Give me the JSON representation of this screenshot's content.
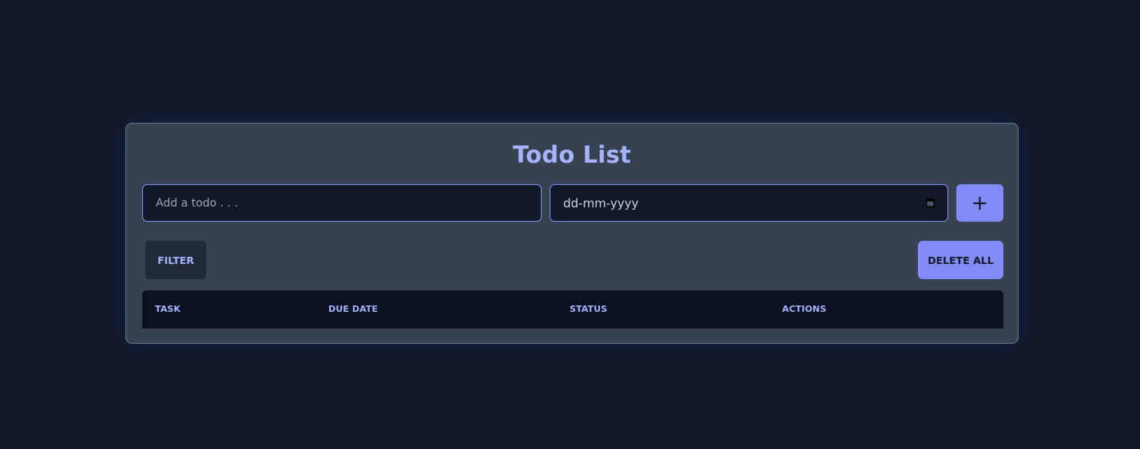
{
  "app": {
    "title": "Todo List"
  },
  "form": {
    "todo_placeholder": "Add a todo . . .",
    "todo_value": "",
    "date_placeholder": "dd-mm-yyyy",
    "add_label": "+"
  },
  "toolbar": {
    "filter_label": "FILTER",
    "delete_all_label": "DELETE ALL"
  },
  "table": {
    "columns": [
      "TASK",
      "DUE DATE",
      "STATUS",
      "ACTIONS"
    ],
    "rows": []
  },
  "icons": {
    "date_picker": "calendar-icon",
    "add": "plus-icon"
  },
  "colors": {
    "background": "#111827",
    "card": "#374151",
    "accent": "#818cf8",
    "accent_text": "#a5b4fc",
    "input_bg": "#111827",
    "table_header_bg": "#0b1120",
    "filter_bg": "#1f2937"
  }
}
